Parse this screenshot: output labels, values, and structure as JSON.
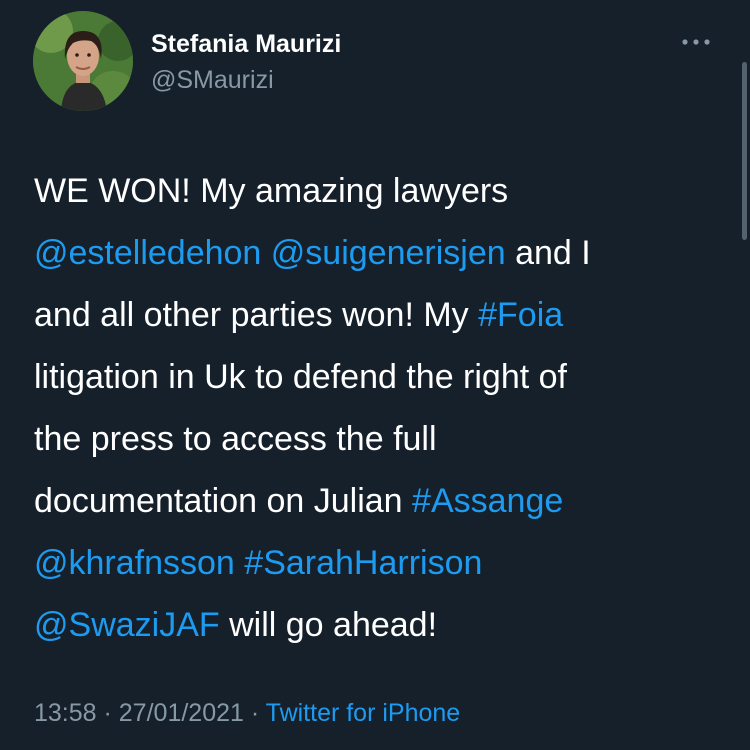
{
  "author": {
    "name": "Stefania Maurizi",
    "handle": "@SMaurizi"
  },
  "icons": {
    "more": "more-horizontal-icon",
    "avatar": "profile-photo"
  },
  "colors": {
    "background": "#15202b",
    "text": "#ffffff",
    "secondary": "#8899a6",
    "link": "#1d9bf0"
  },
  "tweet": {
    "lines": [
      [
        {
          "text": "WE WON! My amazing lawyers",
          "link": false
        }
      ],
      [
        {
          "text": "@estelledehon",
          "link": true
        },
        {
          "text": " ",
          "link": false
        },
        {
          "text": "@suigenerisjen",
          "link": true
        },
        {
          "text": " and I",
          "link": false
        }
      ],
      [
        {
          "text": "and all other parties won! My ",
          "link": false
        },
        {
          "text": "#Foia",
          "link": true
        }
      ],
      [
        {
          "text": "litigation in Uk to defend the right of",
          "link": false
        }
      ],
      [
        {
          "text": "the press to access the full",
          "link": false
        }
      ],
      [
        {
          "text": "documentation on Julian ",
          "link": false
        },
        {
          "text": "#Assange",
          "link": true
        }
      ],
      [
        {
          "text": "@khrafnsson",
          "link": true
        },
        {
          "text": " ",
          "link": false
        },
        {
          "text": "#SarahHarrison",
          "link": true
        }
      ],
      [
        {
          "text": "@SwaziJAF",
          "link": true
        },
        {
          "text": " will go ahead!",
          "link": false
        }
      ]
    ]
  },
  "meta": {
    "time": "13:58",
    "separator": " · ",
    "date": "27/01/2021",
    "source": "Twitter for iPhone"
  }
}
